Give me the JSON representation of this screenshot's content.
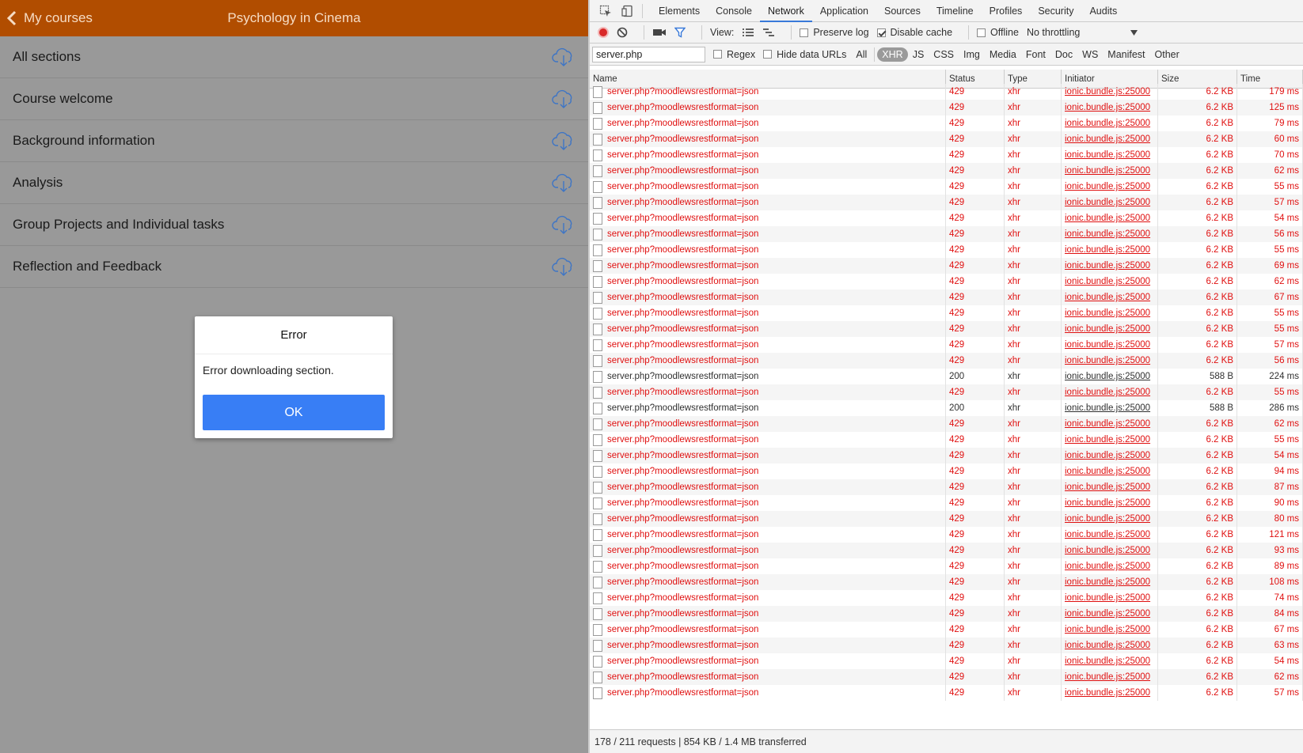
{
  "app": {
    "back_label": "My courses",
    "title": "Psychology in Cinema",
    "sections": [
      {
        "label": "All sections"
      },
      {
        "label": "Course welcome"
      },
      {
        "label": "Background information"
      },
      {
        "label": "Analysis"
      },
      {
        "label": "Group Projects and Individual tasks"
      },
      {
        "label": "Reflection and Feedback"
      }
    ],
    "dialog": {
      "title": "Error",
      "message": "Error downloading section.",
      "ok_label": "OK"
    }
  },
  "devtools": {
    "tabs": [
      "Elements",
      "Console",
      "Network",
      "Application",
      "Sources",
      "Timeline",
      "Profiles",
      "Security",
      "Audits"
    ],
    "active_tab": "Network",
    "toolbar": {
      "view_label": "View:",
      "preserve_log": "Preserve log",
      "disable_cache": "Disable cache",
      "offline": "Offline",
      "throttling": "No throttling"
    },
    "filter": {
      "value": "server.php",
      "regex": "Regex",
      "hide_data_urls": "Hide data URLs",
      "types": [
        "All",
        "XHR",
        "JS",
        "CSS",
        "Img",
        "Media",
        "Font",
        "Doc",
        "WS",
        "Manifest",
        "Other"
      ],
      "active_type": "XHR"
    },
    "columns": {
      "name": "Name",
      "status": "Status",
      "type": "Type",
      "initiator": "Initiator",
      "size": "Size",
      "time": "Time"
    },
    "rows": [
      {
        "name": "server.php?moodlewsrestformat=json",
        "status": "429",
        "type": "xhr",
        "initiator": "ionic.bundle.js:25000",
        "size": "6.2 KB",
        "time": "179 ms"
      },
      {
        "name": "server.php?moodlewsrestformat=json",
        "status": "429",
        "type": "xhr",
        "initiator": "ionic.bundle.js:25000",
        "size": "6.2 KB",
        "time": "125 ms"
      },
      {
        "name": "server.php?moodlewsrestformat=json",
        "status": "429",
        "type": "xhr",
        "initiator": "ionic.bundle.js:25000",
        "size": "6.2 KB",
        "time": "79 ms"
      },
      {
        "name": "server.php?moodlewsrestformat=json",
        "status": "429",
        "type": "xhr",
        "initiator": "ionic.bundle.js:25000",
        "size": "6.2 KB",
        "time": "60 ms"
      },
      {
        "name": "server.php?moodlewsrestformat=json",
        "status": "429",
        "type": "xhr",
        "initiator": "ionic.bundle.js:25000",
        "size": "6.2 KB",
        "time": "70 ms"
      },
      {
        "name": "server.php?moodlewsrestformat=json",
        "status": "429",
        "type": "xhr",
        "initiator": "ionic.bundle.js:25000",
        "size": "6.2 KB",
        "time": "62 ms"
      },
      {
        "name": "server.php?moodlewsrestformat=json",
        "status": "429",
        "type": "xhr",
        "initiator": "ionic.bundle.js:25000",
        "size": "6.2 KB",
        "time": "55 ms"
      },
      {
        "name": "server.php?moodlewsrestformat=json",
        "status": "429",
        "type": "xhr",
        "initiator": "ionic.bundle.js:25000",
        "size": "6.2 KB",
        "time": "57 ms"
      },
      {
        "name": "server.php?moodlewsrestformat=json",
        "status": "429",
        "type": "xhr",
        "initiator": "ionic.bundle.js:25000",
        "size": "6.2 KB",
        "time": "54 ms"
      },
      {
        "name": "server.php?moodlewsrestformat=json",
        "status": "429",
        "type": "xhr",
        "initiator": "ionic.bundle.js:25000",
        "size": "6.2 KB",
        "time": "56 ms"
      },
      {
        "name": "server.php?moodlewsrestformat=json",
        "status": "429",
        "type": "xhr",
        "initiator": "ionic.bundle.js:25000",
        "size": "6.2 KB",
        "time": "55 ms"
      },
      {
        "name": "server.php?moodlewsrestformat=json",
        "status": "429",
        "type": "xhr",
        "initiator": "ionic.bundle.js:25000",
        "size": "6.2 KB",
        "time": "69 ms"
      },
      {
        "name": "server.php?moodlewsrestformat=json",
        "status": "429",
        "type": "xhr",
        "initiator": "ionic.bundle.js:25000",
        "size": "6.2 KB",
        "time": "62 ms"
      },
      {
        "name": "server.php?moodlewsrestformat=json",
        "status": "429",
        "type": "xhr",
        "initiator": "ionic.bundle.js:25000",
        "size": "6.2 KB",
        "time": "67 ms"
      },
      {
        "name": "server.php?moodlewsrestformat=json",
        "status": "429",
        "type": "xhr",
        "initiator": "ionic.bundle.js:25000",
        "size": "6.2 KB",
        "time": "55 ms"
      },
      {
        "name": "server.php?moodlewsrestformat=json",
        "status": "429",
        "type": "xhr",
        "initiator": "ionic.bundle.js:25000",
        "size": "6.2 KB",
        "time": "55 ms"
      },
      {
        "name": "server.php?moodlewsrestformat=json",
        "status": "429",
        "type": "xhr",
        "initiator": "ionic.bundle.js:25000",
        "size": "6.2 KB",
        "time": "57 ms"
      },
      {
        "name": "server.php?moodlewsrestformat=json",
        "status": "429",
        "type": "xhr",
        "initiator": "ionic.bundle.js:25000",
        "size": "6.2 KB",
        "time": "56 ms"
      },
      {
        "name": "server.php?moodlewsrestformat=json",
        "status": "200",
        "type": "xhr",
        "initiator": "ionic.bundle.js:25000",
        "size": "588 B",
        "time": "224 ms"
      },
      {
        "name": "server.php?moodlewsrestformat=json",
        "status": "429",
        "type": "xhr",
        "initiator": "ionic.bundle.js:25000",
        "size": "6.2 KB",
        "time": "55 ms"
      },
      {
        "name": "server.php?moodlewsrestformat=json",
        "status": "200",
        "type": "xhr",
        "initiator": "ionic.bundle.js:25000",
        "size": "588 B",
        "time": "286 ms"
      },
      {
        "name": "server.php?moodlewsrestformat=json",
        "status": "429",
        "type": "xhr",
        "initiator": "ionic.bundle.js:25000",
        "size": "6.2 KB",
        "time": "62 ms"
      },
      {
        "name": "server.php?moodlewsrestformat=json",
        "status": "429",
        "type": "xhr",
        "initiator": "ionic.bundle.js:25000",
        "size": "6.2 KB",
        "time": "55 ms"
      },
      {
        "name": "server.php?moodlewsrestformat=json",
        "status": "429",
        "type": "xhr",
        "initiator": "ionic.bundle.js:25000",
        "size": "6.2 KB",
        "time": "54 ms"
      },
      {
        "name": "server.php?moodlewsrestformat=json",
        "status": "429",
        "type": "xhr",
        "initiator": "ionic.bundle.js:25000",
        "size": "6.2 KB",
        "time": "94 ms"
      },
      {
        "name": "server.php?moodlewsrestformat=json",
        "status": "429",
        "type": "xhr",
        "initiator": "ionic.bundle.js:25000",
        "size": "6.2 KB",
        "time": "87 ms"
      },
      {
        "name": "server.php?moodlewsrestformat=json",
        "status": "429",
        "type": "xhr",
        "initiator": "ionic.bundle.js:25000",
        "size": "6.2 KB",
        "time": "90 ms"
      },
      {
        "name": "server.php?moodlewsrestformat=json",
        "status": "429",
        "type": "xhr",
        "initiator": "ionic.bundle.js:25000",
        "size": "6.2 KB",
        "time": "80 ms"
      },
      {
        "name": "server.php?moodlewsrestformat=json",
        "status": "429",
        "type": "xhr",
        "initiator": "ionic.bundle.js:25000",
        "size": "6.2 KB",
        "time": "121 ms"
      },
      {
        "name": "server.php?moodlewsrestformat=json",
        "status": "429",
        "type": "xhr",
        "initiator": "ionic.bundle.js:25000",
        "size": "6.2 KB",
        "time": "93 ms"
      },
      {
        "name": "server.php?moodlewsrestformat=json",
        "status": "429",
        "type": "xhr",
        "initiator": "ionic.bundle.js:25000",
        "size": "6.2 KB",
        "time": "89 ms"
      },
      {
        "name": "server.php?moodlewsrestformat=json",
        "status": "429",
        "type": "xhr",
        "initiator": "ionic.bundle.js:25000",
        "size": "6.2 KB",
        "time": "108 ms"
      },
      {
        "name": "server.php?moodlewsrestformat=json",
        "status": "429",
        "type": "xhr",
        "initiator": "ionic.bundle.js:25000",
        "size": "6.2 KB",
        "time": "74 ms"
      },
      {
        "name": "server.php?moodlewsrestformat=json",
        "status": "429",
        "type": "xhr",
        "initiator": "ionic.bundle.js:25000",
        "size": "6.2 KB",
        "time": "84 ms"
      },
      {
        "name": "server.php?moodlewsrestformat=json",
        "status": "429",
        "type": "xhr",
        "initiator": "ionic.bundle.js:25000",
        "size": "6.2 KB",
        "time": "67 ms"
      },
      {
        "name": "server.php?moodlewsrestformat=json",
        "status": "429",
        "type": "xhr",
        "initiator": "ionic.bundle.js:25000",
        "size": "6.2 KB",
        "time": "63 ms"
      },
      {
        "name": "server.php?moodlewsrestformat=json",
        "status": "429",
        "type": "xhr",
        "initiator": "ionic.bundle.js:25000",
        "size": "6.2 KB",
        "time": "54 ms"
      },
      {
        "name": "server.php?moodlewsrestformat=json",
        "status": "429",
        "type": "xhr",
        "initiator": "ionic.bundle.js:25000",
        "size": "6.2 KB",
        "time": "62 ms"
      },
      {
        "name": "server.php?moodlewsrestformat=json",
        "status": "429",
        "type": "xhr",
        "initiator": "ionic.bundle.js:25000",
        "size": "6.2 KB",
        "time": "57 ms"
      }
    ],
    "status_bar": "178 / 211 requests  |  854 KB / 1.4 MB transferred"
  }
}
